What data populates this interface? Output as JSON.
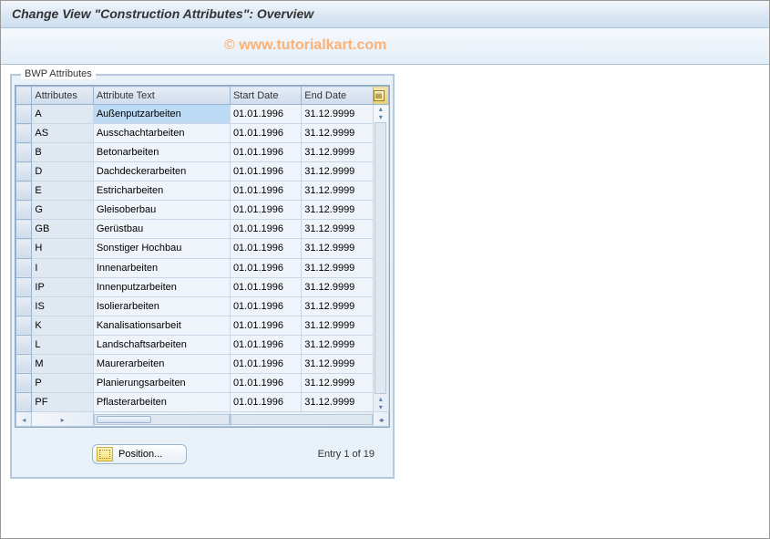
{
  "header": {
    "title": "Change View \"Construction Attributes\": Overview"
  },
  "watermark": "© www.tutorialkart.com",
  "panel": {
    "title": "BWP Attributes"
  },
  "table": {
    "columns": {
      "attr": "Attributes",
      "text": "Attribute Text",
      "start": "Start Date",
      "end": "End Date"
    },
    "rows": [
      {
        "attr": "A",
        "text": "Außenputzarbeiten",
        "start": "01.01.1996",
        "end": "31.12.9999"
      },
      {
        "attr": "AS",
        "text": "Ausschachtarbeiten",
        "start": "01.01.1996",
        "end": "31.12.9999"
      },
      {
        "attr": "B",
        "text": "Betonarbeiten",
        "start": "01.01.1996",
        "end": "31.12.9999"
      },
      {
        "attr": "D",
        "text": "Dachdeckerarbeiten",
        "start": "01.01.1996",
        "end": "31.12.9999"
      },
      {
        "attr": "E",
        "text": "Estricharbeiten",
        "start": "01.01.1996",
        "end": "31.12.9999"
      },
      {
        "attr": "G",
        "text": "Gleisoberbau",
        "start": "01.01.1996",
        "end": "31.12.9999"
      },
      {
        "attr": "GB",
        "text": "Gerüstbau",
        "start": "01.01.1996",
        "end": "31.12.9999"
      },
      {
        "attr": "H",
        "text": "Sonstiger Hochbau",
        "start": "01.01.1996",
        "end": "31.12.9999"
      },
      {
        "attr": "I",
        "text": "Innenarbeiten",
        "start": "01.01.1996",
        "end": "31.12.9999"
      },
      {
        "attr": "IP",
        "text": "Innenputzarbeiten",
        "start": "01.01.1996",
        "end": "31.12.9999"
      },
      {
        "attr": "IS",
        "text": "Isolierarbeiten",
        "start": "01.01.1996",
        "end": "31.12.9999"
      },
      {
        "attr": "K",
        "text": "Kanalisationsarbeit",
        "start": "01.01.1996",
        "end": "31.12.9999"
      },
      {
        "attr": "L",
        "text": "Landschaftsarbeiten",
        "start": "01.01.1996",
        "end": "31.12.9999"
      },
      {
        "attr": "M",
        "text": "Maurerarbeiten",
        "start": "01.01.1996",
        "end": "31.12.9999"
      },
      {
        "attr": "P",
        "text": "Planierungsarbeiten",
        "start": "01.01.1996",
        "end": "31.12.9999"
      },
      {
        "attr": "PF",
        "text": "Pflasterarbeiten",
        "start": "01.01.1996",
        "end": "31.12.9999"
      }
    ]
  },
  "footer": {
    "position_label": "Position...",
    "entry_text": "Entry 1 of 19"
  }
}
